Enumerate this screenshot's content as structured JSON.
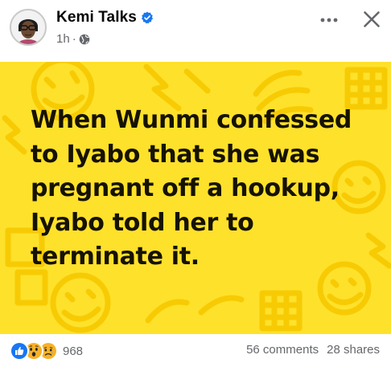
{
  "post": {
    "author": "Kemi Talks",
    "time": "1h",
    "separator": "·",
    "verified_icon": "verified-badge-icon",
    "audience_icon": "globe-icon",
    "more_icon": "more-options-icon",
    "close_icon": "close-icon",
    "image": {
      "background_color": "#fee12b",
      "text": "When Wunmi confessed to Iyabo that she was pregnant off a hookup, Iyabo told her to terminate it."
    },
    "reactions": {
      "icons": [
        "like-icon",
        "wow-icon",
        "sad-icon"
      ],
      "count": "968"
    },
    "comments": "56 comments",
    "shares": "28 shares"
  },
  "colors": {
    "accent": "#1877f2",
    "secondary_text": "#65676b",
    "image_yellow": "#fee12b"
  }
}
